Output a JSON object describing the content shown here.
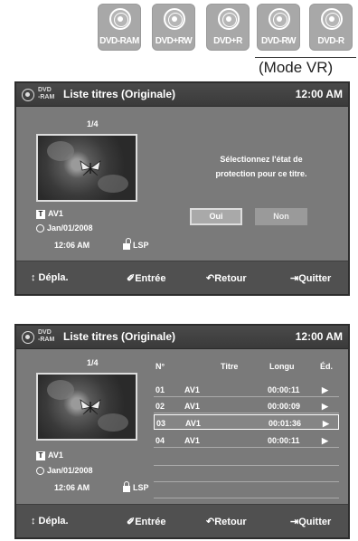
{
  "badges": [
    "DVD-RAM",
    "DVD+RW",
    "DVD+R",
    "DVD-RW",
    "DVD-R"
  ],
  "mode_label": "(Mode VR)",
  "common": {
    "disc_label_1": "DVD",
    "disc_label_2": "-RAM",
    "title": "Liste titres (Originale)",
    "time": "12:00 AM",
    "counter": "1/4",
    "item_title": "AV1",
    "item_date": "Jan/01/2008",
    "item_time": "12:06 AM",
    "item_quality": "LSP",
    "footer": {
      "move": "↕ Dépla.",
      "enter": "Entrée",
      "back": "Retour",
      "quit": "Quitter"
    }
  },
  "panel1": {
    "prompt_line1": "Sélectionnez l'état de",
    "prompt_line2": "protection pour ce titre.",
    "yes": "Oui",
    "no": "Non"
  },
  "panel2": {
    "headers": [
      "N°",
      "Titre",
      "Longu",
      "Éd."
    ],
    "rows": [
      {
        "num": "01",
        "title": "AV1",
        "length": "00:00:11",
        "play": "▶"
      },
      {
        "num": "02",
        "title": "AV1",
        "length": "00:00:09",
        "play": "▶"
      },
      {
        "num": "03",
        "title": "AV1",
        "length": "00:01:36",
        "play": "▶"
      },
      {
        "num": "04",
        "title": "AV1",
        "length": "00:00:11",
        "play": "▶"
      }
    ],
    "selected_row": 3
  },
  "icons": [
    "disc-icon",
    "title-icon",
    "clock-icon",
    "lock-icon",
    "unlock-icon",
    "enter-icon",
    "return-icon",
    "quit-icon"
  ]
}
